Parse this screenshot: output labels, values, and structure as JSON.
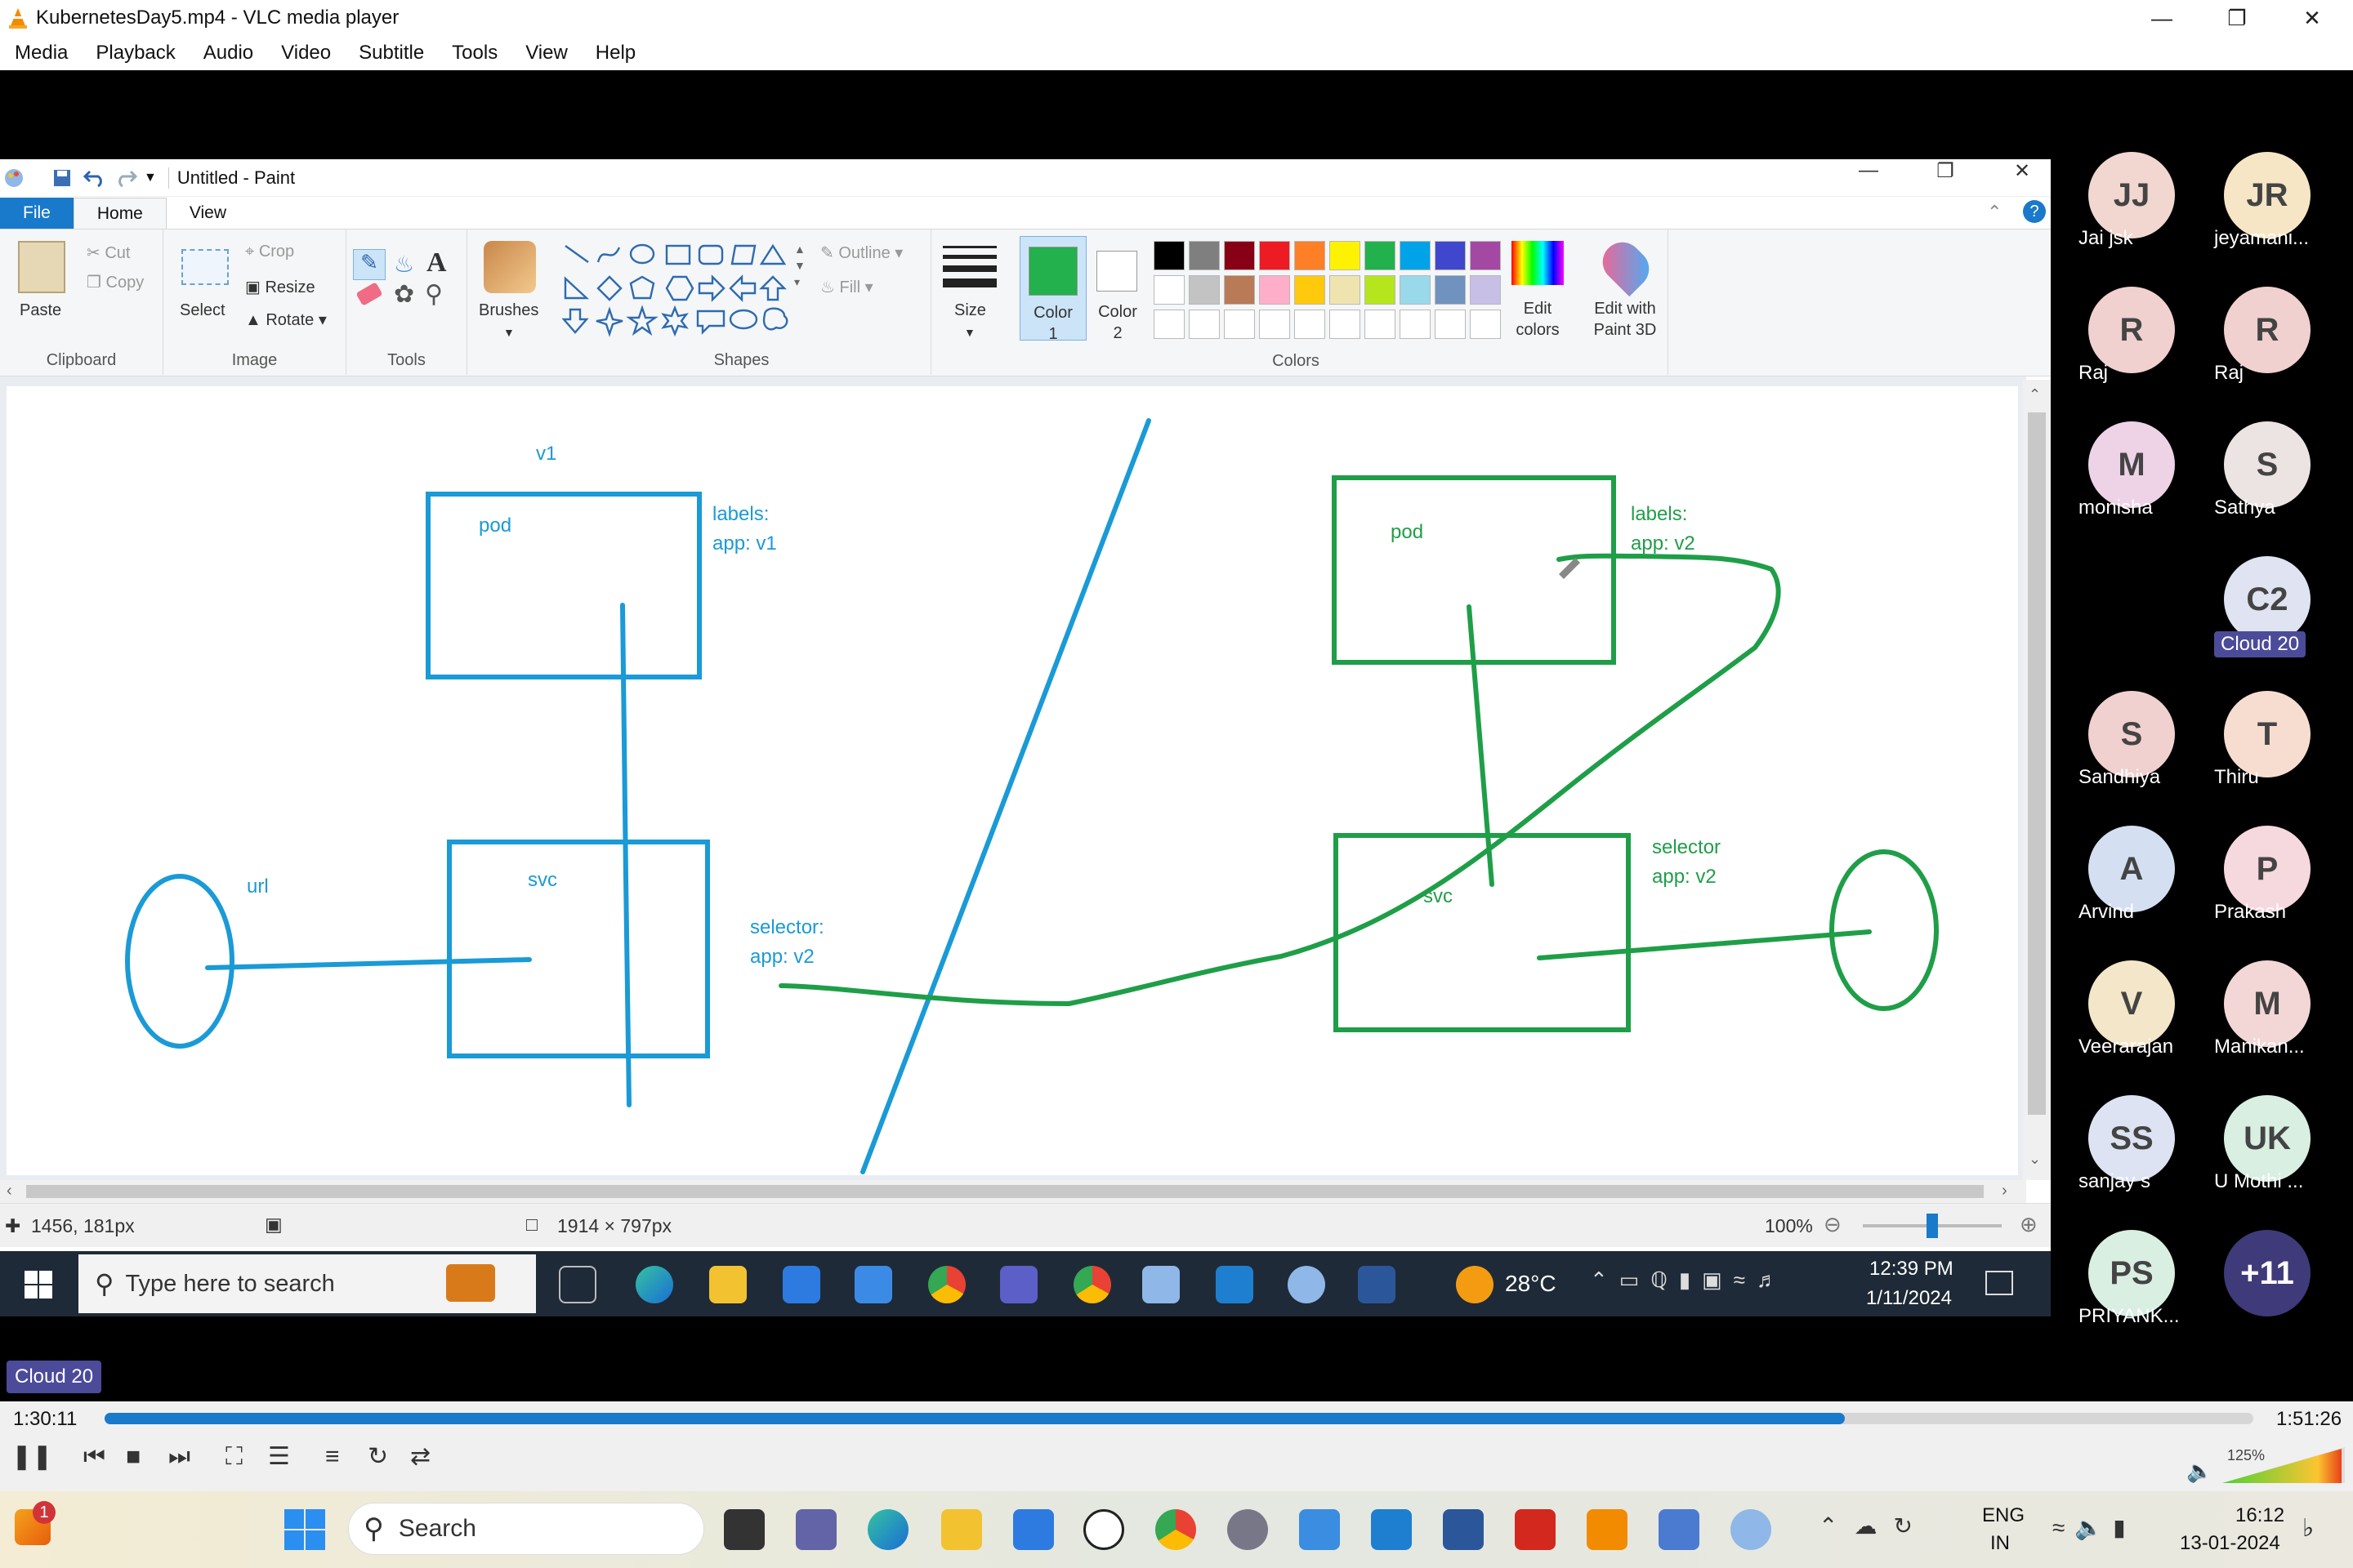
{
  "vlc": {
    "title": "KubernetesDay5.mp4 - VLC media player",
    "menu": [
      "Media",
      "Playback",
      "Audio",
      "Video",
      "Subtitle",
      "Tools",
      "View",
      "Help"
    ],
    "time_elapsed": "1:30:11",
    "time_total": "1:51:26",
    "progress": 0.81,
    "volume_label": "125%",
    "overlay_label": "Cloud 20"
  },
  "paint": {
    "title": "Untitled - Paint",
    "tabs": [
      "File",
      "Home",
      "View"
    ],
    "clipboard": {
      "paste": "Paste",
      "cut": "Cut",
      "copy": "Copy",
      "label": "Clipboard"
    },
    "image": {
      "select": "Select",
      "crop": "Crop",
      "resize": "Resize",
      "rotate": "Rotate",
      "label": "Image"
    },
    "tools_label": "Tools",
    "brushes": "Brushes",
    "shapes": {
      "outline": "Outline",
      "fill": "Fill",
      "label": "Shapes"
    },
    "size": "Size",
    "color1": "Color\n1",
    "color1_a": "Color",
    "color1_b": "1",
    "color2_a": "Color",
    "color2_b": "2",
    "edit_colors_a": "Edit",
    "edit_colors_b": "colors",
    "paint3d_a": "Edit with",
    "paint3d_b": "Paint 3D",
    "colors_label": "Colors",
    "palette_row1": [
      "#000000",
      "#7f7f7f",
      "#880015",
      "#ed1c24",
      "#ff7f27",
      "#fff200",
      "#22b14c",
      "#00a2e8",
      "#3f48cc",
      "#a349a4"
    ],
    "palette_row2": [
      "#ffffff",
      "#c3c3c3",
      "#b97a57",
      "#ffaec9",
      "#ffc90e",
      "#efe4b0",
      "#b5e61d",
      "#99d9ea",
      "#7092be",
      "#c8bfe7"
    ],
    "status": {
      "cursor": "1456, 181px",
      "size": "1914 × 797px",
      "zoom": "100%"
    }
  },
  "drawing": {
    "v1": "v1",
    "pod_left": "pod",
    "labels_left_1": "labels:",
    "labels_left_2": "app: v1",
    "svc_left": "svc",
    "url": "url",
    "selector_mid_1": "selector:",
    "selector_mid_2": "app:  v2",
    "pod_right": "pod",
    "labels_right_1": "labels:",
    "labels_right_2": "app: v2",
    "svc_right": "svc",
    "selector_right_1": "selector",
    "selector_right_2": "app: v2",
    "blue": "#1a9ad6",
    "green": "#1f9e48"
  },
  "inner_taskbar": {
    "search": "Type here to search",
    "weather": "28°C",
    "time": "12:39 PM",
    "date": "1/11/2024"
  },
  "participants": [
    {
      "initials": "JJ",
      "name": "Jai jsk",
      "bg": "#f1d7d0"
    },
    {
      "initials": "JR",
      "name": "jeyamani...",
      "bg": "#f6e6c6"
    },
    {
      "initials": "R",
      "name": "Raj",
      "bg": "#f1d0d0"
    },
    {
      "initials": "R",
      "name": "Raj",
      "bg": "#f1d0d0"
    },
    {
      "initials": "M",
      "name": "monisha",
      "bg": "#eed3e7"
    },
    {
      "initials": "S",
      "name": "Sathya",
      "bg": "#ece4e2"
    },
    {
      "initials": "C2",
      "name": "Cloud 20",
      "bg": "#dfe3f2"
    },
    {
      "initials": "S",
      "name": "Sandhiya",
      "bg": "#f1d0d0"
    },
    {
      "initials": "T",
      "name": "Thiru",
      "bg": "#f6ddd0"
    },
    {
      "initials": "A",
      "name": "Arvind",
      "bg": "#d4dff2"
    },
    {
      "initials": "P",
      "name": "Prakash",
      "bg": "#f6d8df"
    },
    {
      "initials": "V",
      "name": "Veerarajan",
      "bg": "#f4e6c8"
    },
    {
      "initials": "M",
      "name": "Manikan...",
      "bg": "#f3d6d6"
    },
    {
      "initials": "SS",
      "name": "sanjay s",
      "bg": "#dde3f2"
    },
    {
      "initials": "UK",
      "name": "U Mothi ...",
      "bg": "#d8efe2"
    },
    {
      "initials": "PS",
      "name": "PRIYANK...",
      "bg": "#d8efe2"
    },
    {
      "initials": "+11",
      "name": "",
      "bg": "#3f3a7a"
    }
  ],
  "taskbar": {
    "search": "Search",
    "lang1": "ENG",
    "lang2": "IN",
    "time": "16:12",
    "date": "13-01-2024",
    "badge": "1"
  }
}
